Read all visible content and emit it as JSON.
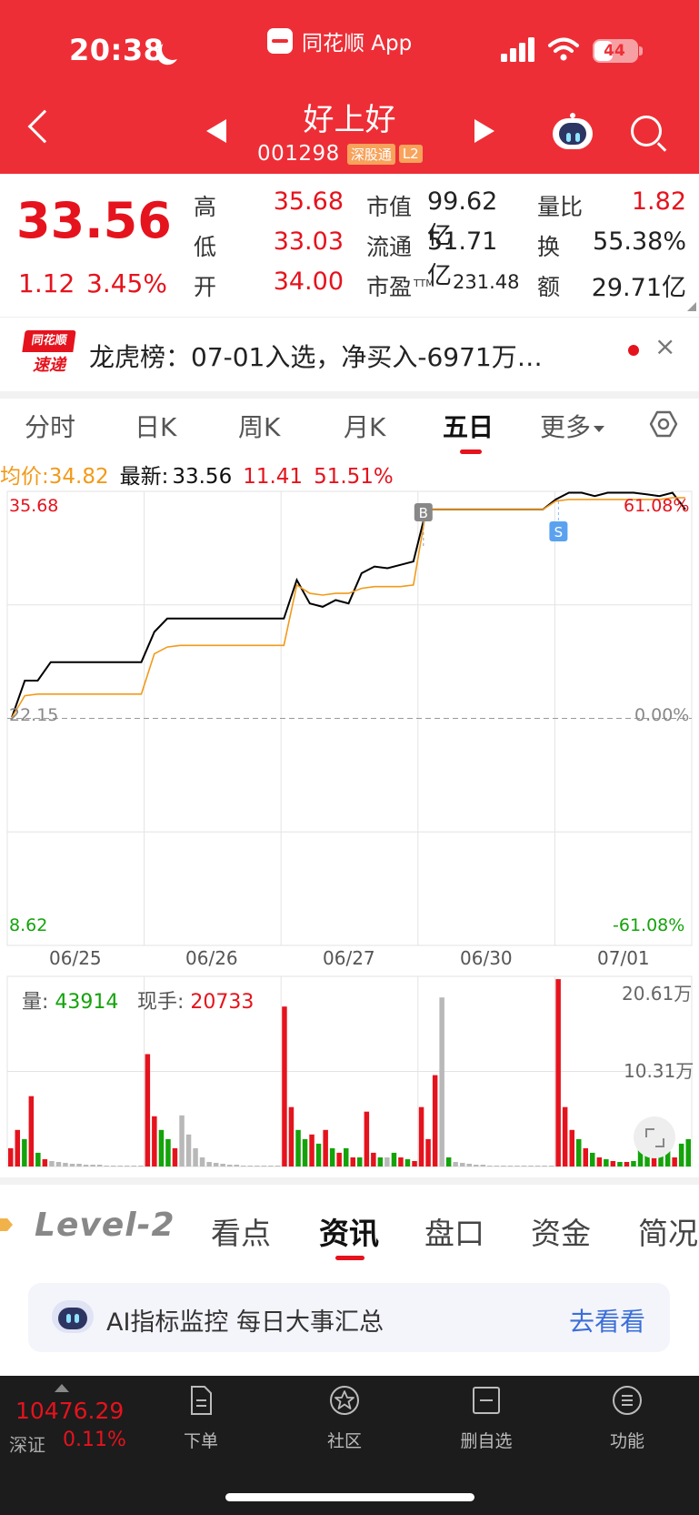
{
  "status_bar": {
    "time": "20:38",
    "app_name": "同花顺 App",
    "battery": "44"
  },
  "header": {
    "stock_name": "好上好",
    "stock_code": "001298",
    "tags": [
      "深股通",
      "L2"
    ]
  },
  "quote": {
    "price": "33.56",
    "change": "1.12",
    "change_pct": "3.45%",
    "rows": [
      {
        "l1": "高",
        "v1": "35.68",
        "l2": "市值",
        "v2": "99.62亿",
        "l3": "量比",
        "v3": "1.82"
      },
      {
        "l1": "低",
        "v1": "33.03",
        "l2": "流通",
        "v2": "51.71亿",
        "l3": "换",
        "v3": "55.38%"
      },
      {
        "l1": "开",
        "v1": "34.00",
        "l2": "市盈",
        "v2": "231.48",
        "l3": "额",
        "v3": "29.71亿",
        "ttm": "TTM"
      }
    ]
  },
  "news": {
    "logo_top": "同花顺",
    "logo_bottom": "速递",
    "text": "龙虎榜：07-01入选，净买入-6971万…",
    "close": "×"
  },
  "chart_tabs": {
    "items": [
      "分时",
      "日K",
      "周K",
      "月K",
      "五日",
      "更多"
    ],
    "active": "五日"
  },
  "info": {
    "avg_label": "均价:",
    "avg": "34.82",
    "last_label": "最新:",
    "last": "33.56",
    "change": "11.41",
    "change_pct": "51.51%"
  },
  "chart_data": {
    "type": "line",
    "x_dates": [
      "06/25",
      "06/26",
      "06/27",
      "06/30",
      "07/01"
    ],
    "y_axis_left": {
      "max": "35.68",
      "mid": "22.15",
      "min": "8.62"
    },
    "y_axis_right": {
      "max": "61.08%",
      "mid": "0.00%",
      "min": "-61.08%"
    },
    "ylim": [
      8.62,
      35.68
    ],
    "reference_price": 22.15,
    "series": [
      {
        "key": "price",
        "color": "#000000",
        "values": [
          22.2,
          24.4,
          24.4,
          25.5,
          25.5,
          25.5,
          25.5,
          25.5,
          25.5,
          25.5,
          25.5,
          27.3,
          28.1,
          28.1,
          28.1,
          28.1,
          28.1,
          28.1,
          28.1,
          28.1,
          28.1,
          28.1,
          30.4,
          29.0,
          28.8,
          29.2,
          29.0,
          30.8,
          31.2,
          31.1,
          31.3,
          31.5,
          34.6,
          34.6,
          34.6,
          34.6,
          34.6,
          34.6,
          34.6,
          34.6,
          34.6,
          34.6,
          35.2,
          35.6,
          35.6,
          35.4,
          35.6,
          35.6,
          35.6,
          35.5,
          35.4,
          35.6,
          34.6
        ]
      },
      {
        "key": "average",
        "color": "#f29a19",
        "values": [
          22.2,
          23.5,
          23.6,
          23.6,
          23.6,
          23.6,
          23.6,
          23.6,
          23.6,
          23.6,
          23.6,
          26.0,
          26.4,
          26.5,
          26.5,
          26.5,
          26.5,
          26.5,
          26.5,
          26.5,
          26.5,
          26.5,
          30.1,
          29.6,
          29.5,
          29.6,
          29.6,
          29.9,
          30.0,
          30.0,
          30.0,
          30.1,
          34.6,
          34.6,
          34.6,
          34.6,
          34.6,
          34.6,
          34.6,
          34.6,
          34.6,
          34.6,
          35.1,
          35.2,
          35.2,
          35.2,
          35.2,
          35.2,
          35.2,
          35.2,
          35.2,
          35.3,
          35.3
        ]
      }
    ],
    "markers": [
      {
        "label": "B",
        "day": "06/30"
      },
      {
        "label": "S",
        "day": "07/01"
      }
    ],
    "volume": {
      "label": "量:",
      "value": "43914",
      "hand_label": "现手:",
      "hand_value": "20733",
      "y_top": "20.61万",
      "y_mid": "10.31万",
      "max": 20.61,
      "bars": [
        [
          2.0,
          "r"
        ],
        [
          4.0,
          "r"
        ],
        [
          3.0,
          "g"
        ],
        [
          7.7,
          "r"
        ],
        [
          1.5,
          "g"
        ],
        [
          0.8,
          "r"
        ],
        [
          0.6,
          "x"
        ],
        [
          0.5,
          "x"
        ],
        [
          0.4,
          "x"
        ],
        [
          0.3,
          "x"
        ],
        [
          0.3,
          "x"
        ],
        [
          0.2,
          "x"
        ],
        [
          0.2,
          "x"
        ],
        [
          0.2,
          "x"
        ],
        [
          0.1,
          "x"
        ],
        [
          0.1,
          "x"
        ],
        [
          0.1,
          "x"
        ],
        [
          0.1,
          "x"
        ],
        [
          0.1,
          "x"
        ],
        [
          0.1,
          "x"
        ],
        [
          12.3,
          "r"
        ],
        [
          5.5,
          "r"
        ],
        [
          4.0,
          "g"
        ],
        [
          3.0,
          "g"
        ],
        [
          2.0,
          "r"
        ],
        [
          5.6,
          "x"
        ],
        [
          3.5,
          "x"
        ],
        [
          2.0,
          "x"
        ],
        [
          1.0,
          "x"
        ],
        [
          0.5,
          "x"
        ],
        [
          0.4,
          "x"
        ],
        [
          0.3,
          "x"
        ],
        [
          0.2,
          "x"
        ],
        [
          0.2,
          "x"
        ],
        [
          0.1,
          "x"
        ],
        [
          0.1,
          "x"
        ],
        [
          0.1,
          "x"
        ],
        [
          0.1,
          "x"
        ],
        [
          0.1,
          "x"
        ],
        [
          0.1,
          "x"
        ],
        [
          17.5,
          "r"
        ],
        [
          6.5,
          "r"
        ],
        [
          4.0,
          "g"
        ],
        [
          3.0,
          "g"
        ],
        [
          3.5,
          "r"
        ],
        [
          2.5,
          "g"
        ],
        [
          4.0,
          "r"
        ],
        [
          2.0,
          "g"
        ],
        [
          1.5,
          "r"
        ],
        [
          2.0,
          "g"
        ],
        [
          1.0,
          "r"
        ],
        [
          1.0,
          "g"
        ],
        [
          6.0,
          "r"
        ],
        [
          1.5,
          "r"
        ],
        [
          1.0,
          "g"
        ],
        [
          1.0,
          "x"
        ],
        [
          1.5,
          "g"
        ],
        [
          1.0,
          "r"
        ],
        [
          0.8,
          "g"
        ],
        [
          0.6,
          "r"
        ],
        [
          6.5,
          "r"
        ],
        [
          3.0,
          "r"
        ],
        [
          10.0,
          "r"
        ],
        [
          18.5,
          "x"
        ],
        [
          1.0,
          "g"
        ],
        [
          0.5,
          "x"
        ],
        [
          0.4,
          "x"
        ],
        [
          0.3,
          "x"
        ],
        [
          0.2,
          "x"
        ],
        [
          0.2,
          "x"
        ],
        [
          0.1,
          "x"
        ],
        [
          0.1,
          "x"
        ],
        [
          0.1,
          "x"
        ],
        [
          0.1,
          "x"
        ],
        [
          0.1,
          "x"
        ],
        [
          0.1,
          "x"
        ],
        [
          0.1,
          "x"
        ],
        [
          0.1,
          "x"
        ],
        [
          0.1,
          "x"
        ],
        [
          0.1,
          "x"
        ],
        [
          20.5,
          "r"
        ],
        [
          6.5,
          "r"
        ],
        [
          4.0,
          "r"
        ],
        [
          3.0,
          "g"
        ],
        [
          2.0,
          "r"
        ],
        [
          1.5,
          "g"
        ],
        [
          1.0,
          "r"
        ],
        [
          0.8,
          "g"
        ],
        [
          0.6,
          "r"
        ],
        [
          0.5,
          "g"
        ],
        [
          0.5,
          "r"
        ],
        [
          0.6,
          "g"
        ],
        [
          3.0,
          "g"
        ],
        [
          2.0,
          "g"
        ],
        [
          1.5,
          "r"
        ],
        [
          1.8,
          "g"
        ],
        [
          3.5,
          "g"
        ],
        [
          1.0,
          "r"
        ],
        [
          2.5,
          "g"
        ],
        [
          3.0,
          "g"
        ]
      ]
    }
  },
  "section_tabs": {
    "level2": "Level-2",
    "items": [
      "看点",
      "资讯",
      "盘口",
      "资金",
      "简况"
    ],
    "active": "资讯"
  },
  "ai_card": {
    "text": "AI指标监控 每日大事汇总",
    "action": "去看看"
  },
  "bottom_bar": {
    "index_value": "10476.29",
    "index_name": "深证",
    "index_pct": "0.11%",
    "items": [
      "下单",
      "社区",
      "删自选",
      "功能"
    ]
  },
  "colors": {
    "brand_red": "#ee2e36",
    "up_red": "#e5131d",
    "down_green": "#14a30b",
    "avg_orange": "#f29a19",
    "link_blue": "#3b6fd8"
  }
}
